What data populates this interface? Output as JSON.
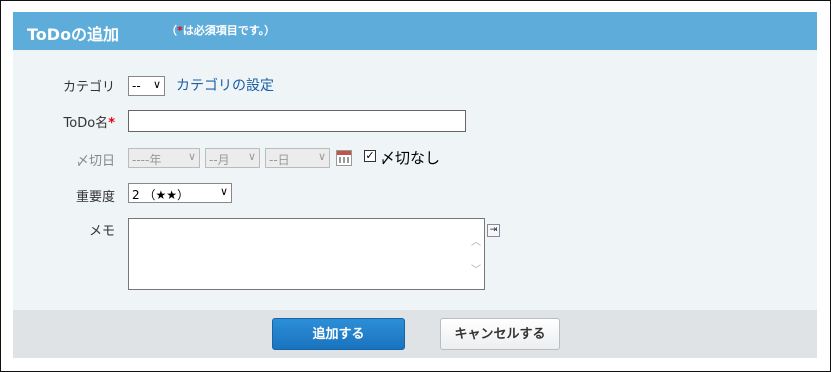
{
  "header": {
    "title": "ToDoの追加",
    "note_prefix": "（",
    "note_required_mark": "*",
    "note_suffix": "は必須項目です。）"
  },
  "form": {
    "category": {
      "label": "カテゴリ",
      "value": "--",
      "link": "カテゴリの設定"
    },
    "name": {
      "label": "ToDo名",
      "required_mark": "*",
      "value": ""
    },
    "deadline": {
      "label": "〆切日",
      "year": "----年",
      "month": "--月",
      "day": "--日",
      "no_deadline_label": "〆切なし",
      "no_deadline_checked": true,
      "checkmark": "✓"
    },
    "priority": {
      "label": "重要度",
      "value": "2 （★★）"
    },
    "memo": {
      "label": "メモ",
      "value": ""
    }
  },
  "actions": {
    "submit": "追加する",
    "cancel": "キャンセルする"
  },
  "icons": {
    "chevron": "∨",
    "scroll_up": "︿",
    "scroll_down": "﹀",
    "expand": "⇥"
  },
  "colors": {
    "header": "#5dacd9",
    "required": "#e60012",
    "link": "#1a5fa8",
    "primary": "#1a73be"
  }
}
